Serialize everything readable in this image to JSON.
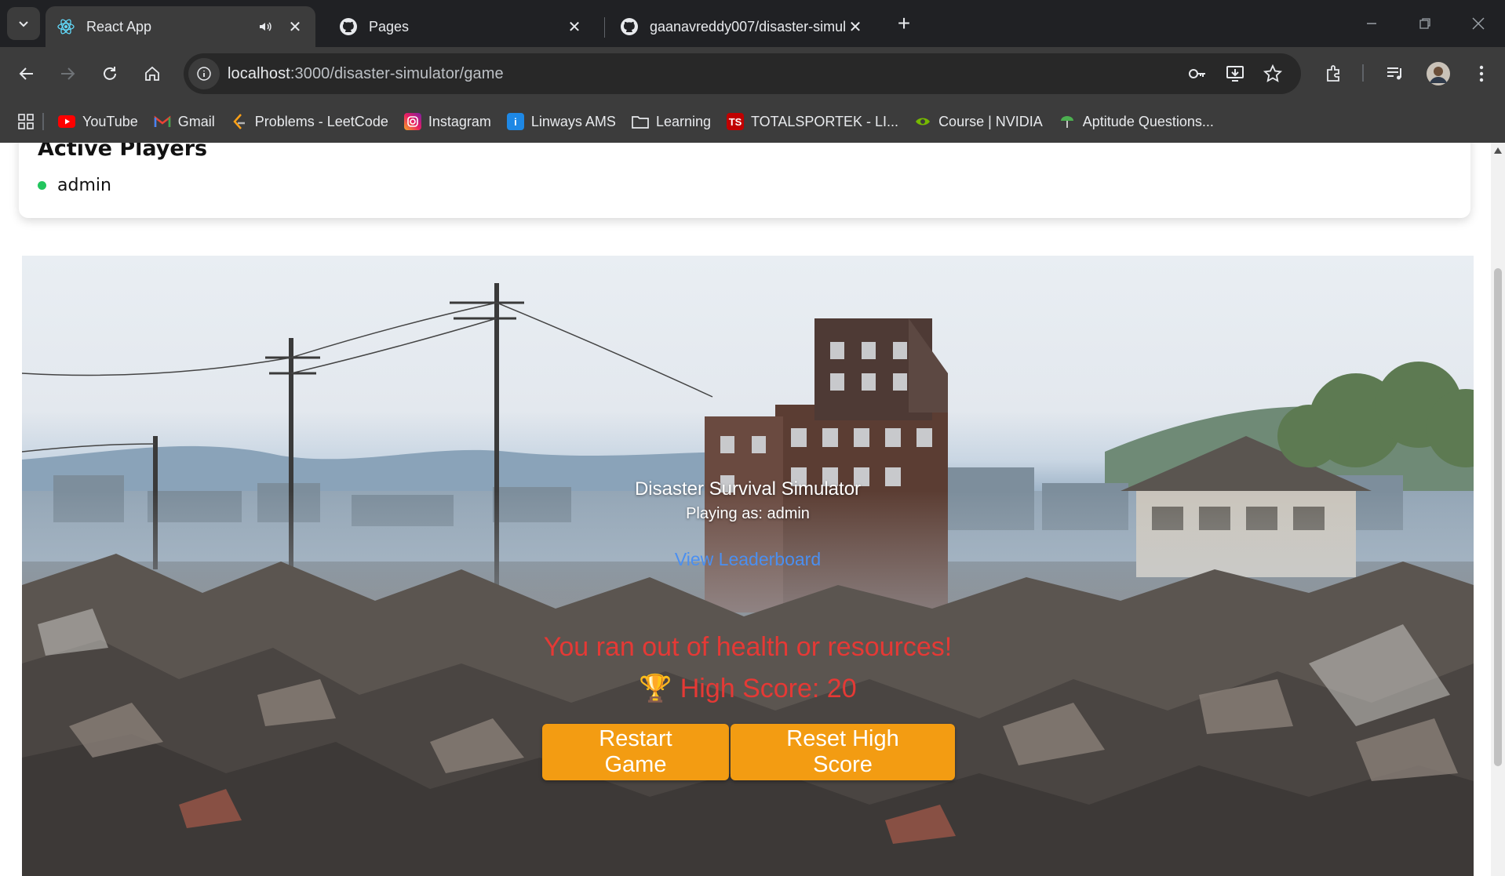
{
  "tabs": [
    {
      "title": "React App",
      "icon": "react-icon",
      "active": true,
      "audio": true
    },
    {
      "title": "Pages",
      "icon": "github-icon",
      "active": false
    },
    {
      "title": "gaanavreddy007/disaster-simul",
      "icon": "github-icon",
      "active": false
    }
  ],
  "address_bar": {
    "host": "localhost",
    "path": ":3000/disaster-simulator/game"
  },
  "bookmarks": [
    {
      "label": "YouTube",
      "icon": "youtube-icon",
      "color": "#ff0000"
    },
    {
      "label": "Gmail",
      "icon": "gmail-icon",
      "color": "#ea4335"
    },
    {
      "label": "Problems - LeetCode",
      "icon": "leetcode-icon",
      "color": "#ffa116"
    },
    {
      "label": "Instagram",
      "icon": "instagram-icon",
      "color": "#d6249f"
    },
    {
      "label": "Linways AMS",
      "icon": "info-icon",
      "color": "#1e88e5"
    },
    {
      "label": "Learning",
      "icon": "folder-icon",
      "color": "#e8eaed"
    },
    {
      "label": "TOTALSPORTEK - LI...",
      "icon": "ts-icon",
      "color": "#c00000",
      "icon_text": "TS"
    },
    {
      "label": "Course | NVIDIA",
      "icon": "nvidia-icon",
      "color": "#76b900"
    },
    {
      "label": "Aptitude Questions...",
      "icon": "aptitude-icon",
      "color": "#4caf50"
    }
  ],
  "page": {
    "players": {
      "title": "Active Players",
      "list": [
        "admin"
      ]
    },
    "game": {
      "title": "Disaster Survival Simulator",
      "player_line": "Playing as: admin",
      "leaderboard_link": "View Leaderboard",
      "game_over": "You ran out of health or resources!",
      "high_score_icon": "🏆",
      "high_score": "High Score: 20",
      "restart_label": "Restart Game",
      "reset_label": "Reset High Score"
    }
  },
  "colors": {
    "accent_button": "#f39c12",
    "error_text": "#e53935",
    "link": "#4b8ff0",
    "online": "#22c55e"
  }
}
